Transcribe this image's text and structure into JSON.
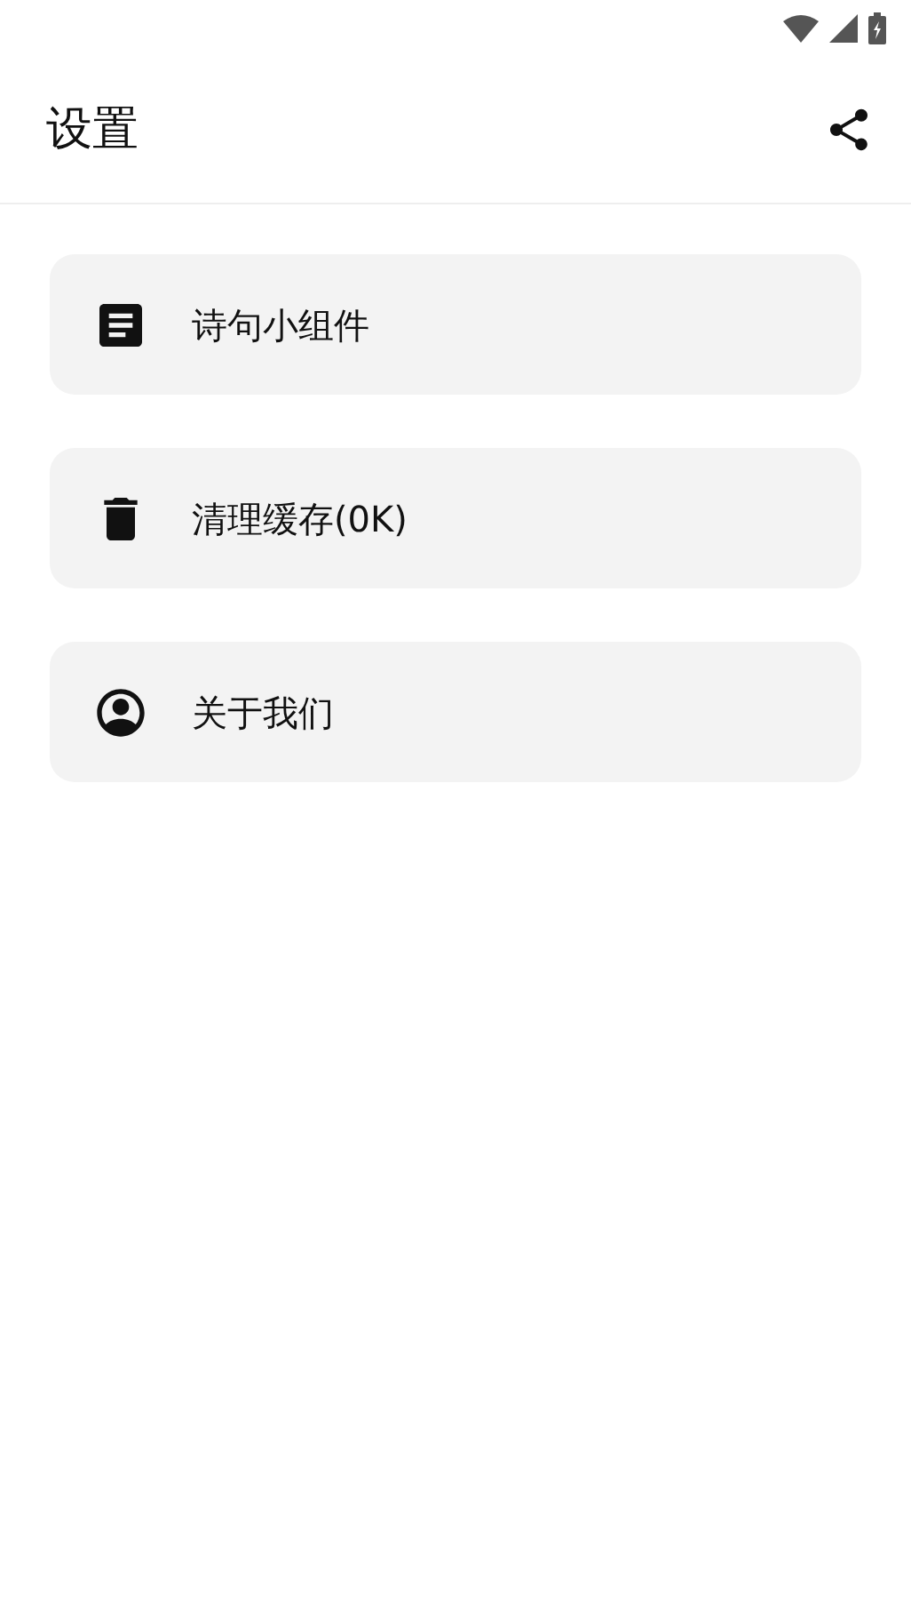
{
  "app_bar": {
    "title": "设置"
  },
  "items": [
    {
      "kind": "document",
      "label": "诗句小组件"
    },
    {
      "kind": "trash",
      "label": "清理缓存(0K)"
    },
    {
      "kind": "account",
      "label": "关于我们"
    }
  ]
}
